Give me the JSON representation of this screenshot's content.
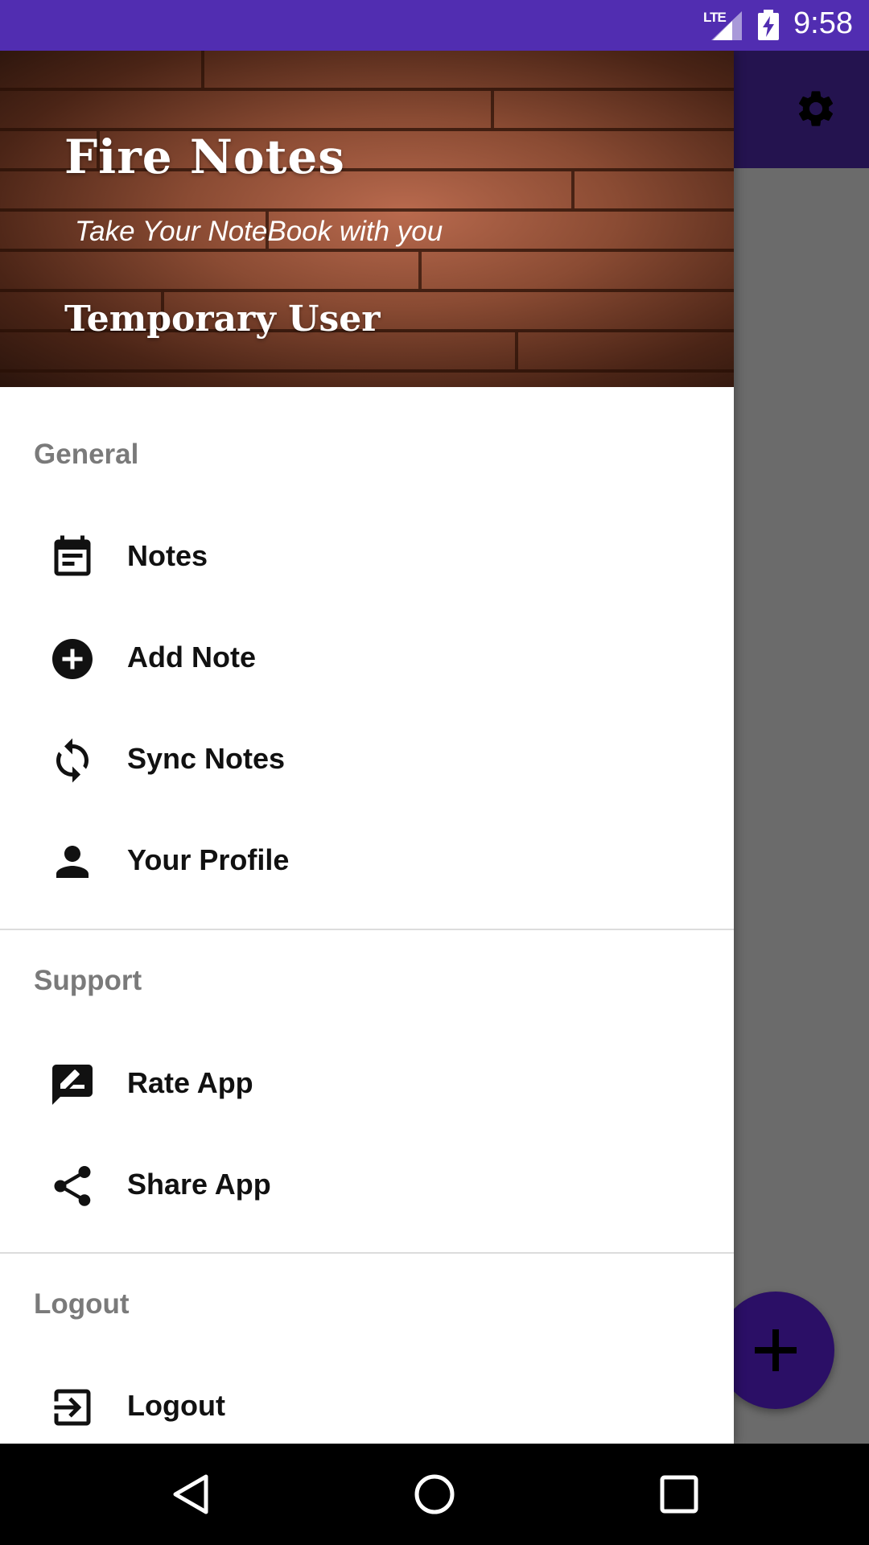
{
  "status_bar": {
    "network": "LTE",
    "time": "9:58"
  },
  "drawer": {
    "header": {
      "app_title": "Fire Notes",
      "tagline": "Take Your NoteBook with you",
      "user_name": "Temporary User"
    },
    "sections": {
      "general": {
        "label": "General",
        "items": [
          {
            "label": "Notes",
            "icon": "notes-icon"
          },
          {
            "label": "Add Note",
            "icon": "add-circle-icon"
          },
          {
            "label": "Sync Notes",
            "icon": "sync-icon"
          },
          {
            "label": "Your Profile",
            "icon": "person-icon"
          }
        ]
      },
      "support": {
        "label": "Support",
        "items": [
          {
            "label": "Rate App",
            "icon": "rate-review-icon"
          },
          {
            "label": "Share App",
            "icon": "share-icon"
          }
        ]
      },
      "logout": {
        "label": "Logout",
        "items": [
          {
            "label": "Logout",
            "icon": "logout-icon"
          }
        ]
      }
    }
  },
  "background_app": {
    "toolbar_action": "gear-icon",
    "fab_icon": "add-icon"
  },
  "colors": {
    "status_bar": "#512db1",
    "dimmed_app_bar": "#24134f",
    "fab": "#2b0f66",
    "scrim": "#6b6b6b"
  }
}
